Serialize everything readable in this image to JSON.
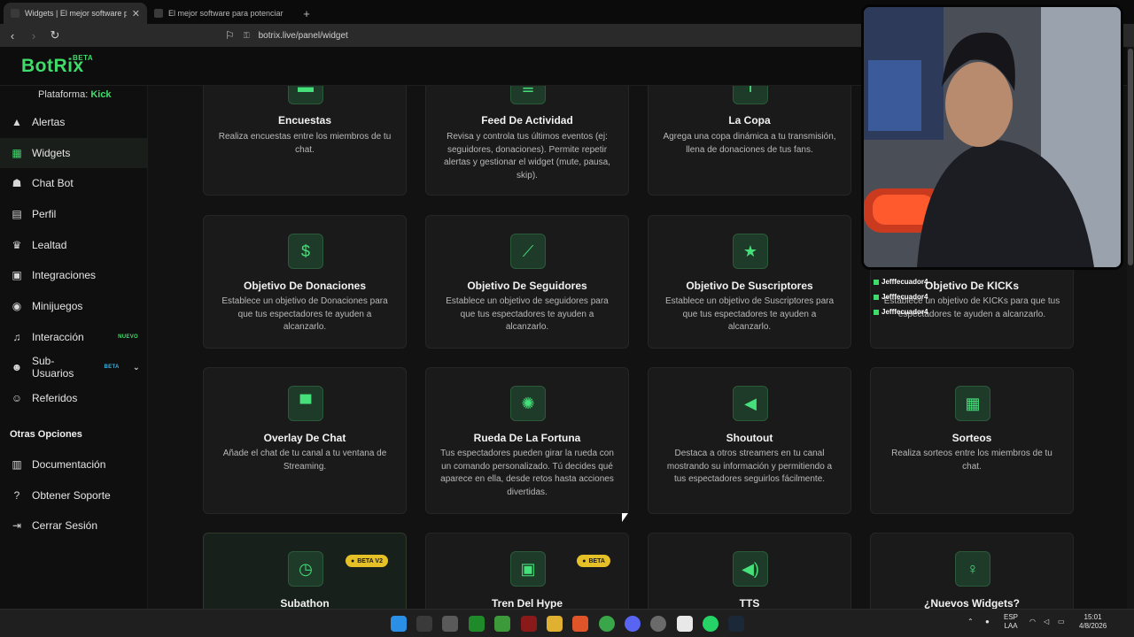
{
  "browser": {
    "tabs": [
      {
        "title": "Widgets | El mejor software para"
      },
      {
        "title": "El mejor software para potenciar"
      }
    ],
    "new_tab": "+",
    "url": "botrix.live/panel/widget"
  },
  "app": {
    "logo": "BotRix",
    "logo_badge": "BETA",
    "platform_label": "Plataforma:",
    "platform_value": "Kick"
  },
  "sidebar": {
    "items": [
      {
        "label": "Alertas",
        "icon": "warning-icon"
      },
      {
        "label": "Widgets",
        "icon": "grid-icon",
        "active": true
      },
      {
        "label": "Chat Bot",
        "icon": "robot-icon"
      },
      {
        "label": "Perfil",
        "icon": "id-card-icon"
      },
      {
        "label": "Lealtad",
        "icon": "trophy-icon"
      },
      {
        "label": "Integraciones",
        "icon": "plug-icon"
      },
      {
        "label": "Minijuegos",
        "icon": "gamepad-icon"
      },
      {
        "label": "Interacción",
        "icon": "music-icon",
        "badge": "NUEVO",
        "badge_color": "#3fdc6a"
      },
      {
        "label": "Sub-Usuarios",
        "icon": "users-icon",
        "badge": "BETA",
        "badge_color": "#3fb0dc"
      },
      {
        "label": "Referidos",
        "icon": "user-group-icon"
      }
    ],
    "other_title": "Otras Opciones",
    "other_items": [
      {
        "label": "Documentación",
        "icon": "book-icon"
      },
      {
        "label": "Obtener Soporte",
        "icon": "help-icon"
      },
      {
        "label": "Cerrar Sesión",
        "icon": "logout-icon"
      }
    ]
  },
  "widgets": [
    {
      "title": "Encuestas",
      "desc": "Realiza encuestas entre los miembros de tu chat.",
      "icon": "poll-icon"
    },
    {
      "title": "Feed De Actividad",
      "desc": "Revisa y controla tus últimos eventos (ej: seguidores, donaciones). Permite repetir alertas y gestionar el widget (mute, pausa, skip).",
      "icon": "list-icon"
    },
    {
      "title": "La Copa",
      "desc": "Agrega una copa dinámica a tu transmisión, llena de donaciones de tus fans.",
      "icon": "cup-icon"
    },
    {
      "title": "Objetivo De Donaciones",
      "desc": "Establece un objetivo de Donaciones para que tus espectadores te ayuden a alcanzarlo.",
      "icon": "dollar-icon"
    },
    {
      "title": "Objetivo De Seguidores",
      "desc": "Establece un objetivo de seguidores para que tus espectadores te ayuden a alcanzarlo.",
      "icon": "chart-line-icon"
    },
    {
      "title": "Objetivo De Suscriptores",
      "desc": "Establece un objetivo de Suscriptores para que tus espectadores te ayuden a alcanzarlo.",
      "icon": "star-icon"
    },
    {
      "title": "Objetivo De KICKs",
      "desc": "Establece un objetivo de KICKs para que tus espectadores te ayuden a alcanzarlo.",
      "icon": "kick-icon"
    },
    {
      "title": "Overlay De Chat",
      "desc": "Añade el chat de tu canal a tu ventana de Streaming.",
      "icon": "chat-icon"
    },
    {
      "title": "Rueda De La Fortuna",
      "desc": "Tus espectadores pueden girar la rueda con un comando personalizado. Tú decides qué aparece en ella, desde retos hasta acciones divertidas.",
      "icon": "wheel-icon"
    },
    {
      "title": "Shoutout",
      "desc": "Destaca a otros streamers en tu canal mostrando su información y permitiendo a tus espectadores seguirlos fácilmente.",
      "icon": "megaphone-icon"
    },
    {
      "title": "Sorteos",
      "desc": "Realiza sorteos entre los miembros de tu chat.",
      "icon": "gift-icon"
    },
    {
      "title": "Subathon",
      "desc": "",
      "icon": "clock-icon",
      "badge": "BETA V2"
    },
    {
      "title": "Tren Del Hype",
      "desc": "",
      "icon": "train-icon",
      "badge": "BETA"
    },
    {
      "title": "TTS",
      "desc": "",
      "icon": "speaker-icon"
    },
    {
      "title": "¿Nuevos Widgets?",
      "desc": "",
      "icon": "lightbulb-icon"
    }
  ],
  "chat_overlay": [
    "Jefffecuador4",
    "Jefffecuador4",
    "Jefffecuador4"
  ],
  "taskbar": {
    "lang_top": "ESP",
    "lang_bottom": "LAA",
    "time": "15:01",
    "date": "4/8/2026"
  },
  "colors": {
    "accent": "#3fdc6a",
    "beta": "#e6c027"
  }
}
